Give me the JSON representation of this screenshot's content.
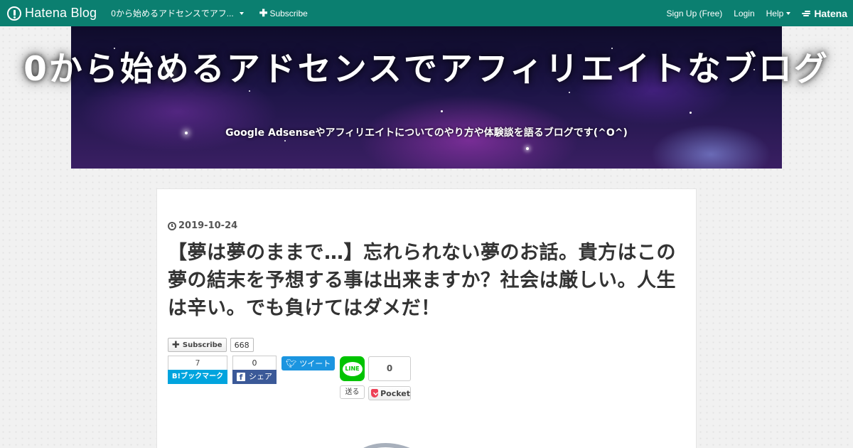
{
  "topbar": {
    "brand": "Hatena Blog",
    "blog_select": "0から始めるアドセンスでアフ...",
    "subscribe": "Subscribe",
    "signup": "Sign Up (Free)",
    "login": "Login",
    "help": "Help",
    "hatena": "Hatena"
  },
  "header": {
    "title": "0から始めるアドセンスでアフィリエイトなブログ",
    "description": "Google Adsenseやアフィリエイトについてのやり方や体験談を語るブログです(^O^)"
  },
  "article": {
    "date": "2019-10-24",
    "title": "【夢は夢のままで…】忘れられない夢のお話。貴方はこの夢の結末を予想する事は出来ますか？社会は厳しい。人生は辛い。でも負けてはダメだ！"
  },
  "share": {
    "subscribe_label": "Subscribe",
    "subscribe_count": "668",
    "hatena_count": "7",
    "hatena_label": "B!ブックマーク",
    "facebook_count": "0",
    "facebook_label": "シェア",
    "twitter_label": "ツイート",
    "line_label": "LINE",
    "line_send": "送る",
    "pocket_count": "0",
    "pocket_label": "Pocket"
  },
  "colors": {
    "topbar": "#0b7f70",
    "hatena_bookmark": "#00a4de",
    "facebook": "#3b5998",
    "twitter": "#1b95e0",
    "line": "#00c300",
    "pocket": "#ee4056"
  }
}
